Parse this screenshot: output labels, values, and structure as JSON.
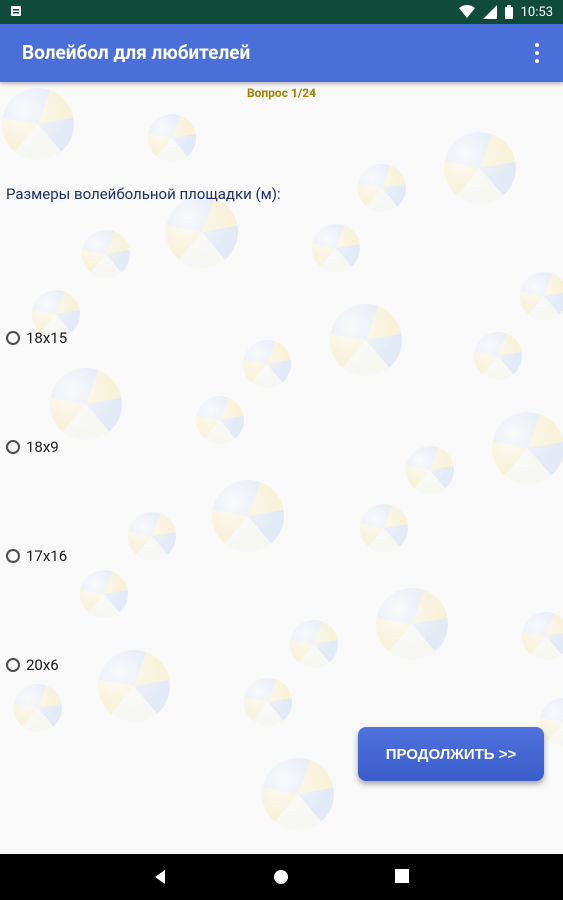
{
  "status_bar": {
    "time": "10:53",
    "icons": [
      "notification-icon",
      "wifi-icon",
      "signal-icon",
      "battery-icon"
    ]
  },
  "app_bar": {
    "title": "Волейбол для любителей",
    "menu_icon": "overflow-menu-icon"
  },
  "quiz": {
    "counter": "Вопрос 1/24",
    "question": "Размеры волейбольной площадки (м):",
    "options": [
      "18x15",
      "18x9",
      "17x16",
      "20x6"
    ]
  },
  "actions": {
    "continue_label": "ПРОДОЛЖИТЬ >>"
  },
  "nav_bar": {
    "icons": [
      "back-icon",
      "home-icon",
      "recents-icon"
    ]
  },
  "colors": {
    "app_bar": "#4a6fd9",
    "status_bar": "#0f4a3a",
    "question_text": "#1f2f63",
    "counter": "#a08200",
    "button": "#3b5cc9"
  }
}
